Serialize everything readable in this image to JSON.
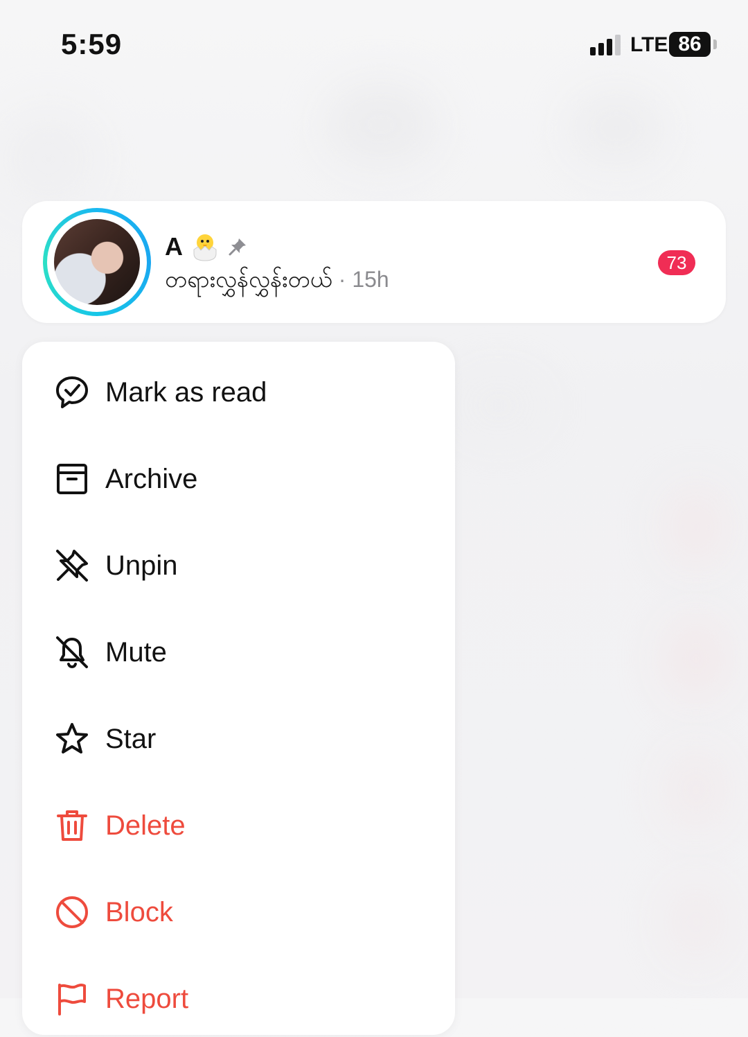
{
  "status_bar": {
    "time": "5:59",
    "network": "LTE",
    "battery": "86"
  },
  "chat": {
    "name": "A",
    "preview": "တရားလွှန်လွှန်းတယ်",
    "time_ago": "· 15h",
    "unread_count": "73"
  },
  "menu": {
    "items": [
      {
        "label": "Mark as read",
        "icon": "chat-check-icon"
      },
      {
        "label": "Archive",
        "icon": "archive-icon"
      },
      {
        "label": "Unpin",
        "icon": "unpin-icon"
      },
      {
        "label": "Mute",
        "icon": "bell-off-icon"
      },
      {
        "label": "Star",
        "icon": "star-icon"
      },
      {
        "label": "Delete",
        "icon": "trash-icon"
      },
      {
        "label": "Block",
        "icon": "block-icon"
      },
      {
        "label": "Report",
        "icon": "flag-icon"
      }
    ]
  },
  "colors": {
    "danger": "#ee4b3d",
    "badge": "#f02d55",
    "ring": "#19b8f1"
  }
}
